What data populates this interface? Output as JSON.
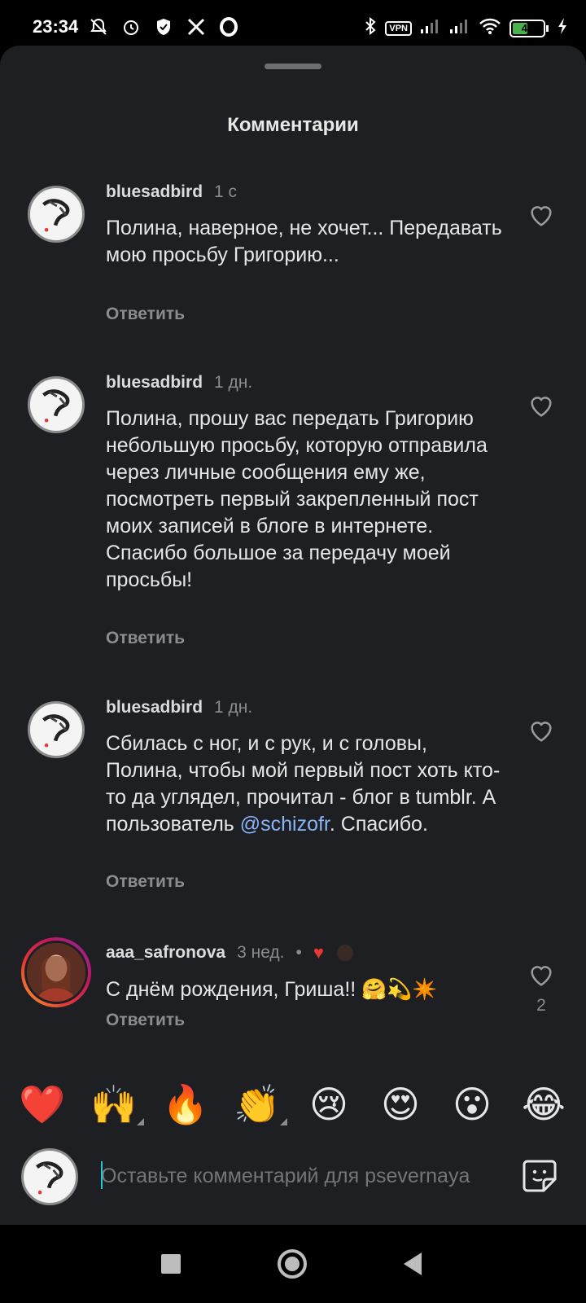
{
  "status_bar": {
    "time": "23:34",
    "left_icons": [
      "notifications-off-icon",
      "alarm-icon",
      "shield-icon",
      "x-logo-icon",
      "opera-icon"
    ],
    "right_icons": [
      "bluetooth-icon",
      "vpn-icon",
      "signal-icon",
      "signal-icon",
      "wifi-icon",
      "battery-icon",
      "charging-icon"
    ],
    "vpn_label": "VPN",
    "battery_level": "43"
  },
  "sheet": {
    "title": "Комментарии"
  },
  "comments": [
    {
      "username": "bluesadbird",
      "time": "1 с",
      "text": "Полина, наверное, не хочет... Передавать мою просьбу Григорию...",
      "reply_label": "Ответить"
    },
    {
      "username": "bluesadbird",
      "time": "1 дн.",
      "text": "Полина, прошу вас передать Григорию небольшую просьбу, которую отправила через личные сообщения ему же, посмотреть первый закрепленный пост моих записей в блоге в интернете. Спасибо большое за передачу моей просьбы!",
      "reply_label": "Ответить"
    },
    {
      "username": "bluesadbird",
      "time": "1 дн.",
      "text_before": "Сбилась с ног, и с рук, и с головы, Полина, чтобы мой первый пост хоть кто-то да углядел, прочитал - блог в tumblr. А пользователь ",
      "mention": "@schizofr",
      "text_after": ". Спасибо.",
      "reply_label": "Ответить"
    },
    {
      "username": "aaa_safronova",
      "time": "3 нед.",
      "separator": "•",
      "text": "С днём рождения, Гриша!! 🤗💫✴️",
      "reply_label": "Ответить",
      "like_count": "2"
    }
  ],
  "emoji_bar": [
    "❤️",
    "🙌",
    "🔥",
    "👏",
    "😢",
    "😍",
    "😮",
    "😂"
  ],
  "composer": {
    "placeholder": "Оставьте комментарий для psevernaya"
  },
  "colors": {
    "sheet_bg": "#1e1f23",
    "mention": "#8ab4f8",
    "muted": "#8b8c90"
  }
}
